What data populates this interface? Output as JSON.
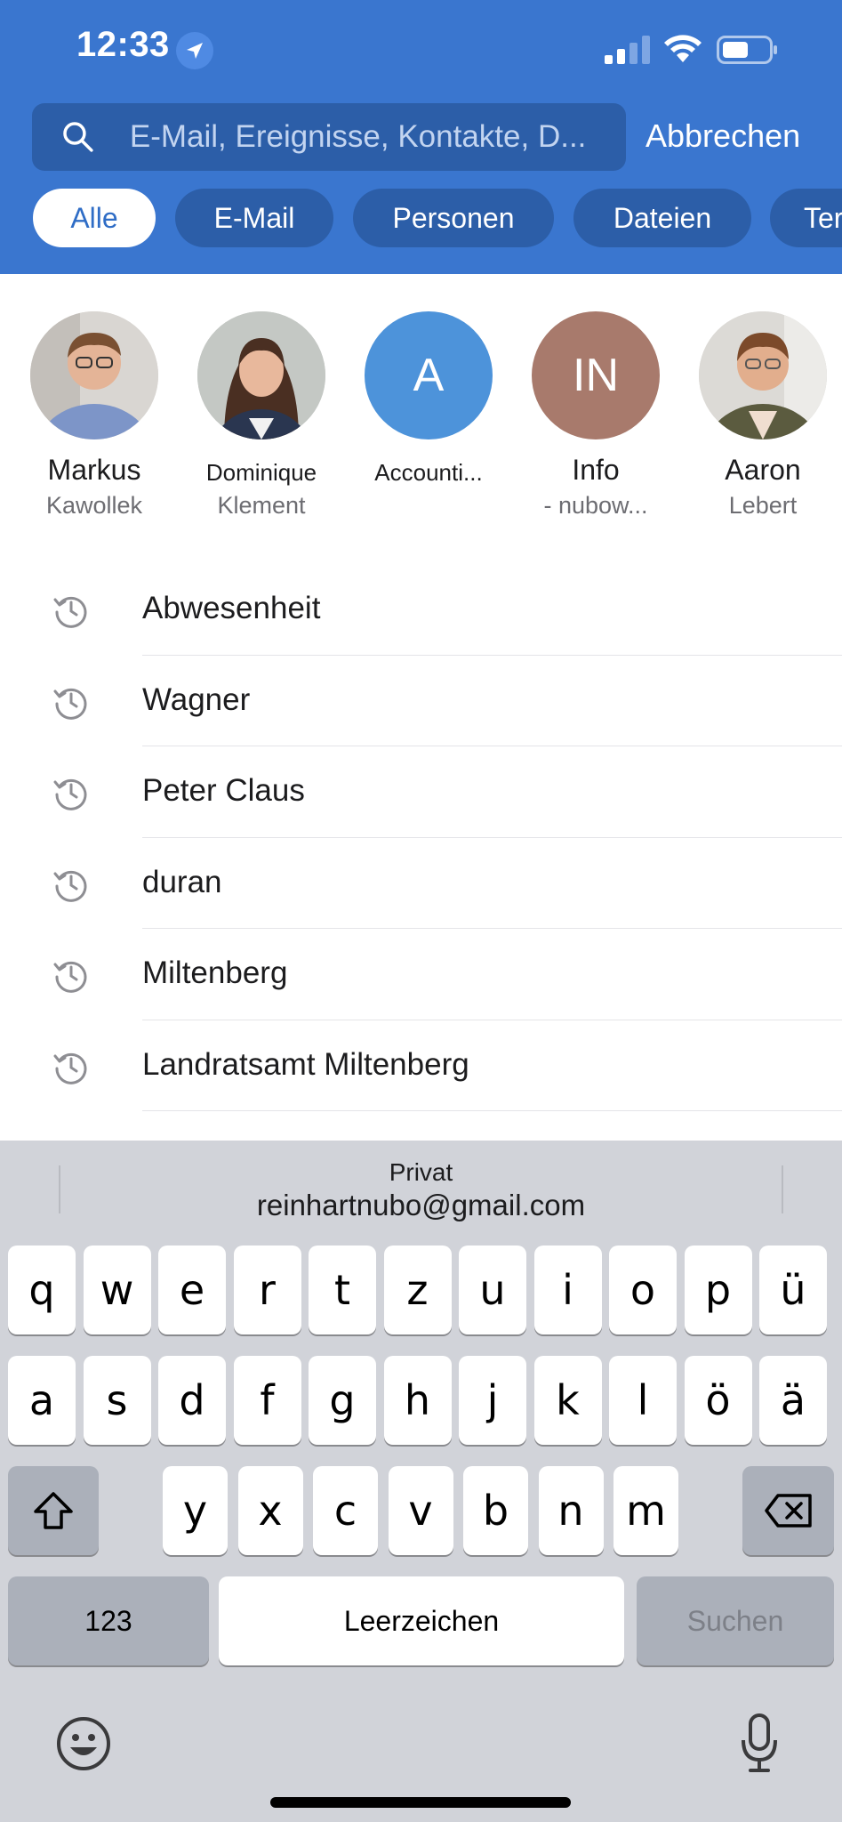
{
  "status_bar": {
    "time": "12:33"
  },
  "search": {
    "placeholder": "E-Mail, Ereignisse, Kontakte, D...",
    "cancel_label": "Abbrechen"
  },
  "filters": [
    {
      "label": "Alle",
      "active": true
    },
    {
      "label": "E-Mail",
      "active": false
    },
    {
      "label": "Personen",
      "active": false
    },
    {
      "label": "Dateien",
      "active": false
    },
    {
      "label": "Ter",
      "active": false
    }
  ],
  "people": [
    {
      "first": "Markus",
      "last": "Kawollek",
      "initials": "",
      "avatar_color": "#c9c3bd"
    },
    {
      "first": "Dominique",
      "last": "Klement",
      "initials": "",
      "avatar_color": "#b7bcb8"
    },
    {
      "first": "Accounti...",
      "last": "",
      "initials": "A",
      "avatar_color": "#4d93da"
    },
    {
      "first": "Info",
      "last": "- nubow...",
      "initials": "IN",
      "avatar_color": "#a87a6c"
    },
    {
      "first": "Aaron",
      "last": "Lebert",
      "initials": "",
      "avatar_color": "#d4d2cd"
    }
  ],
  "history": [
    {
      "label": "Abwesenheit"
    },
    {
      "label": "Wagner"
    },
    {
      "label": "Peter Claus"
    },
    {
      "label": "duran"
    },
    {
      "label": "Miltenberg"
    },
    {
      "label": "Landratsamt Miltenberg"
    }
  ],
  "keyboard": {
    "suggestion_title": "Privat",
    "suggestion_value": "reinhartnubo@gmail.com",
    "row1": [
      "q",
      "w",
      "e",
      "r",
      "t",
      "z",
      "u",
      "i",
      "o",
      "p",
      "ü"
    ],
    "row2": [
      "a",
      "s",
      "d",
      "f",
      "g",
      "h",
      "j",
      "k",
      "l",
      "ö",
      "ä"
    ],
    "row3": [
      "y",
      "x",
      "c",
      "v",
      "b",
      "n",
      "m"
    ],
    "numbers_label": "123",
    "space_label": "Leerzeichen",
    "search_label": "Suchen",
    "shift_icon": "shift-icon",
    "delete_icon": "delete-icon",
    "emoji_icon": "emoji-icon",
    "mic_icon": "microphone-icon"
  },
  "colors": {
    "header_bg": "#3a76cf",
    "chip_bg": "#2c5ea8",
    "active_chip_text": "#2f6dc6",
    "keyboard_bg": "#d1d3d9"
  }
}
